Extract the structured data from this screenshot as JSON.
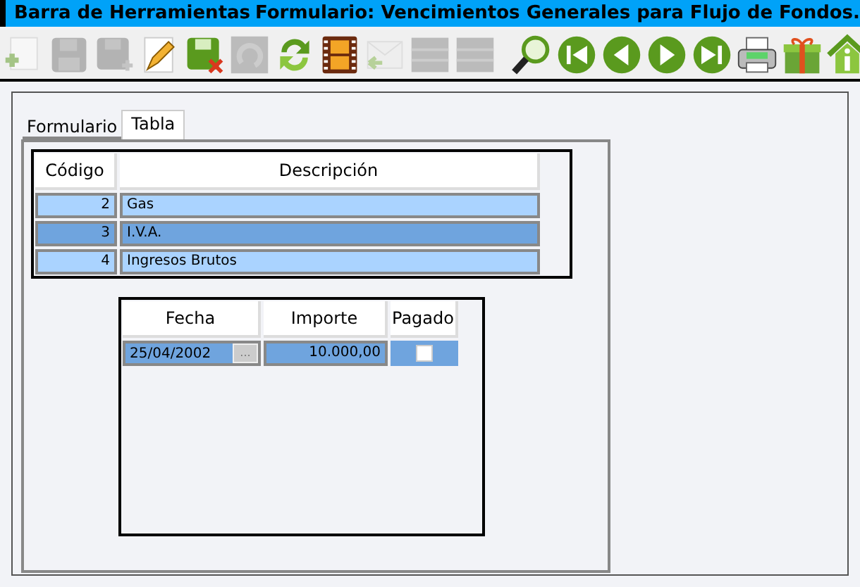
{
  "title_bar": {
    "app": "Barra de Herramientas",
    "form": "Formulario: Vencimientos Generales para Flujo de Fondos."
  },
  "toolbar": [
    {
      "kind": "new",
      "disabled": true
    },
    {
      "kind": "save",
      "disabled": true
    },
    {
      "kind": "save_as",
      "disabled": true
    },
    {
      "kind": "edit",
      "disabled": false
    },
    {
      "kind": "cancel",
      "disabled": false
    },
    {
      "kind": "undo",
      "disabled": true
    },
    {
      "kind": "refresh",
      "disabled": false
    },
    {
      "kind": "film",
      "disabled": false
    },
    {
      "kind": "reply",
      "disabled": true
    },
    {
      "kind": "grid",
      "disabled": true
    },
    {
      "kind": "grid",
      "disabled": true
    },
    {
      "kind": "search",
      "disabled": false
    },
    {
      "kind": "first",
      "disabled": false
    },
    {
      "kind": "prev",
      "disabled": false
    },
    {
      "kind": "next",
      "disabled": false
    },
    {
      "kind": "last",
      "disabled": false
    },
    {
      "kind": "print",
      "disabled": false
    },
    {
      "kind": "gift",
      "disabled": false
    },
    {
      "kind": "home",
      "disabled": false
    }
  ],
  "tabs": [
    {
      "label": "Formulario",
      "selected": false
    },
    {
      "label": "Tabla",
      "selected": true
    }
  ],
  "table": {
    "columns": [
      "Código",
      "Descripción"
    ],
    "rows": [
      {
        "codigo": "2",
        "descripcion": "Gas",
        "selected": false
      },
      {
        "codigo": "3",
        "descripcion": "I.V.A.",
        "selected": true
      },
      {
        "codigo": "4",
        "descripcion": "Ingresos Brutos",
        "selected": false
      }
    ]
  },
  "detail": {
    "columns": [
      "Fecha",
      "Importe",
      "Pagado"
    ],
    "rows": [
      {
        "fecha": "25/04/2002",
        "picker": "...",
        "importe": "10.000,00",
        "pagado": false
      }
    ]
  }
}
